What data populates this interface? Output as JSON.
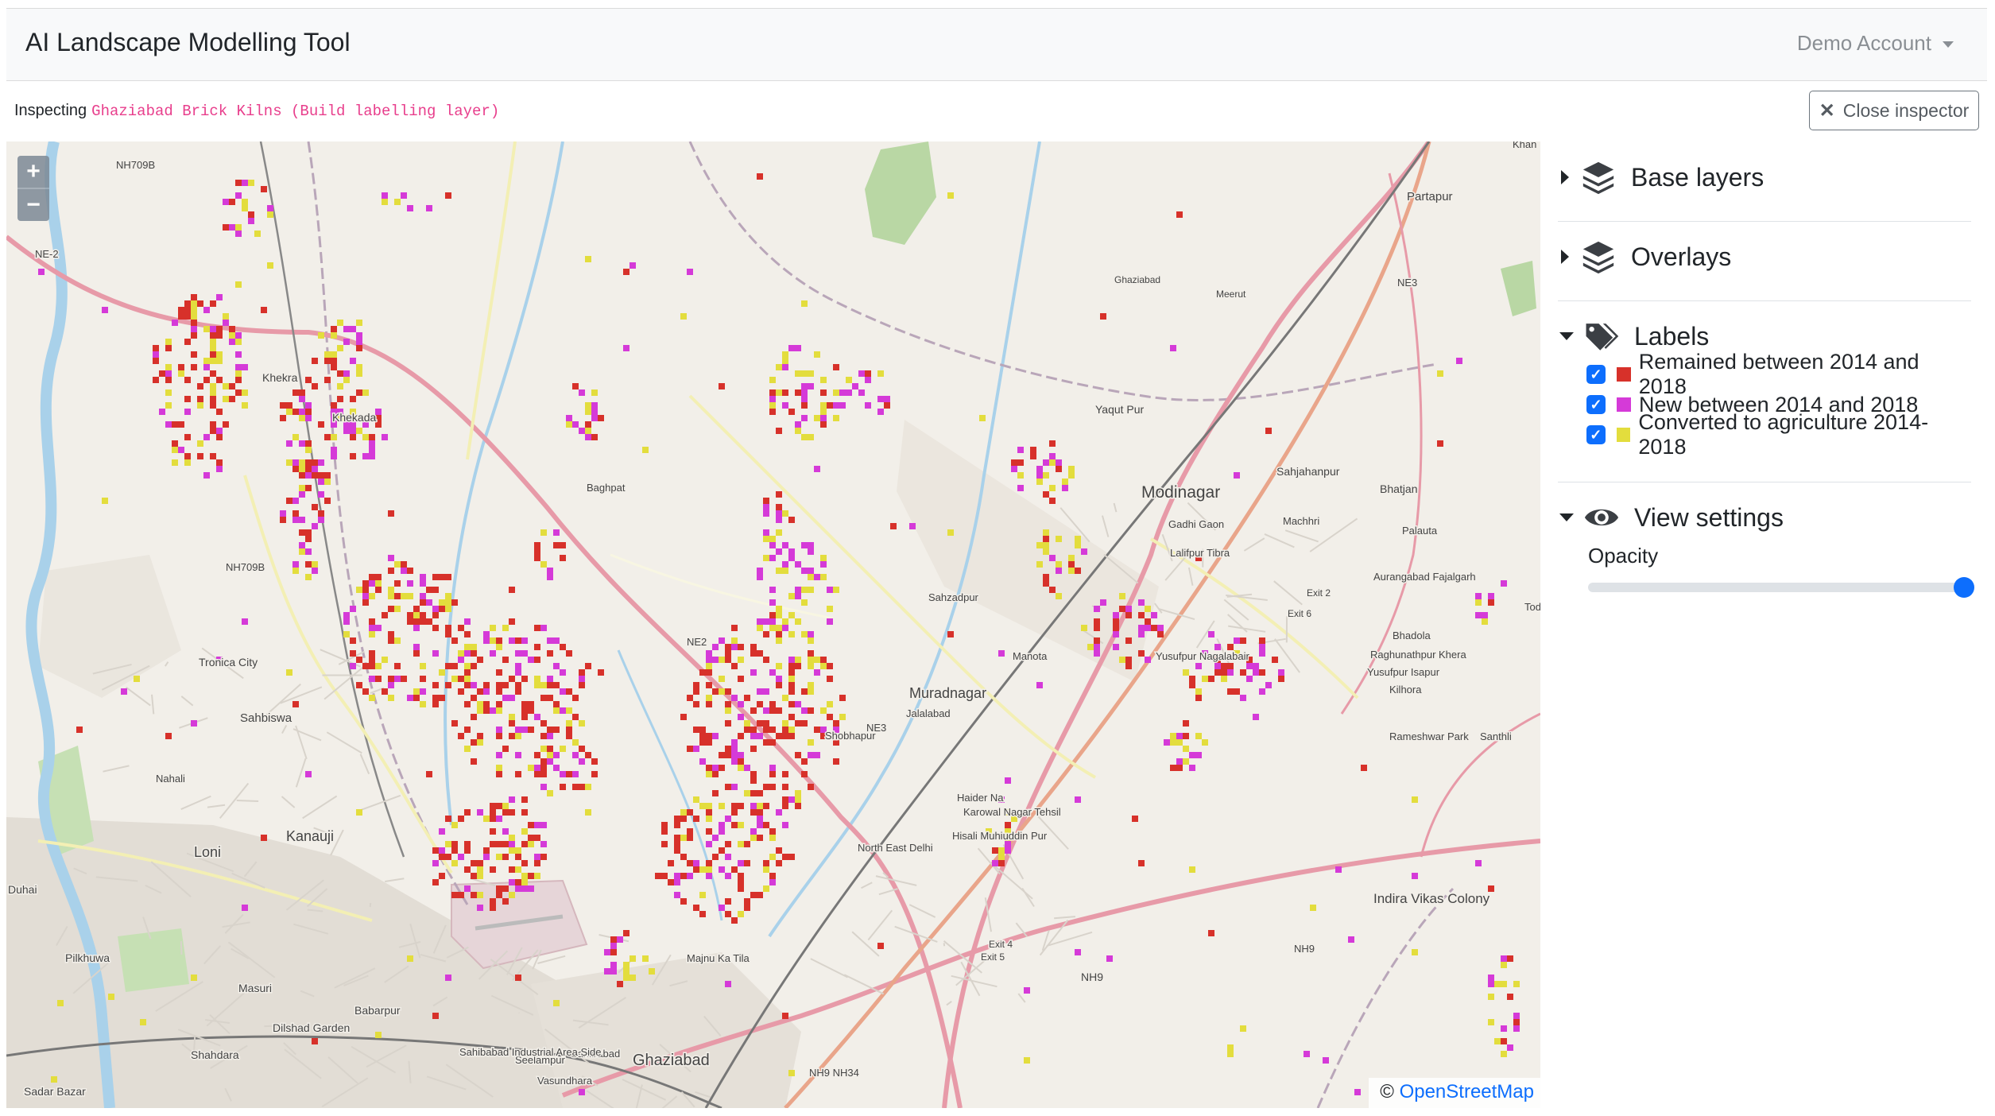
{
  "navbar": {
    "title": "AI Landscape Modelling Tool",
    "account": "Demo Account"
  },
  "inspector": {
    "prefix": "Inspecting",
    "layer_name": "Ghaziabad Brick Kilns (Build labelling layer)",
    "close_label": "Close inspector"
  },
  "map": {
    "zoom_in": "+",
    "zoom_out": "−",
    "attribution_prefix": "©",
    "attribution_link": "OpenStreetMap",
    "place_labels": [
      "Khan",
      "Partapur",
      "NE3",
      "NH709B",
      "NE-2",
      "Khekra",
      "Khekada",
      "Baghpat",
      "Yaqut Pur",
      "Modinagar",
      "Sahjahanpur",
      "Bhatjan",
      "Gadhi Gaon",
      "Machhri",
      "Palauta",
      "Lalifpur Tibra",
      "Aurangabad Fajalgarh",
      "Todi",
      "NH709B",
      "Sahzadpur",
      "Tronica City",
      "NE2",
      "Manota",
      "Yusufpur Nagalabair",
      "Bhadola",
      "Raghunathpur Khera",
      "Yusufpur Isapur",
      "Kilhora",
      "Muradnagar",
      "Jalalabad",
      "NE3",
      "Sahbiswa",
      "Shobhapur",
      "Rameshwar Park",
      "Santhli",
      "Nahali",
      "Haider Na",
      "Karowal Nagar Tehsil",
      "Hisali Muhiuddin Pur",
      "Kanauji",
      "Loni",
      "North East Delhi",
      "Duhai",
      "Indira Vikas Colony",
      "Pilkhuwa",
      "Majnu Ka Tila",
      "NH9",
      "NH9",
      "Masuri",
      "Babarpur",
      "Dilshad Garden",
      "Shahdara",
      "Seelampur",
      "Ghaziabad",
      "Sahibabad",
      "Sahibabad Industrial Area Side",
      "NH9 NH34",
      "Sadar Bazar",
      "Vasundhara",
      "Exit 4",
      "Exit 5",
      "Exit 2",
      "Exit 6",
      "Meerut",
      "Ghaziabad"
    ]
  },
  "panel": {
    "base_layers": "Base layers",
    "overlays": "Overlays",
    "labels_title": "Labels",
    "labels": [
      {
        "text": "Remained between 2014 and 2018",
        "color": "#d7312a"
      },
      {
        "text": "New between 2014 and 2018",
        "color": "#d53ad8"
      },
      {
        "text": "Converted to agriculture 2014-2018",
        "color": "#e3dd3d"
      }
    ],
    "view_settings": "View settings",
    "opacity_label": "Opacity",
    "opacity_value": 1.0
  },
  "colors": {
    "accent": "#0d6efd",
    "code": "#e83e8c",
    "remained": "#d7312a",
    "new": "#d53ad8",
    "converted": "#e3dd3d"
  }
}
